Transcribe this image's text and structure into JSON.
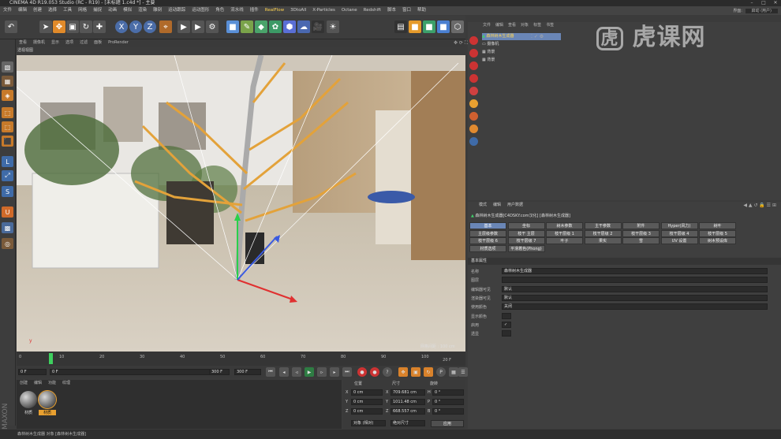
{
  "app": {
    "title": "CINEMA 4D R19.053 Studio (RC - R19) - [未标题 1.c4d *] - 主要"
  },
  "menu": [
    "文件",
    "编辑",
    "创建",
    "选择",
    "工具",
    "网格",
    "捕捉",
    "动画",
    "模拟",
    "渲染",
    "雕刻",
    "运动跟踪",
    "运动图形",
    "角色",
    "流水线",
    "插件",
    "RealFlow",
    "3DtoAll",
    "X-Particles",
    "Octane",
    "Redshift",
    "脚本",
    "窗口",
    "帮助"
  ],
  "menu_highlight": "RealFlow",
  "layout_label": "界面:",
  "layout_value": "启动 (用户)",
  "viewport": {
    "menu": [
      "查看",
      "摄像机",
      "显示",
      "选项",
      "过滤",
      "面板",
      "ProRender"
    ],
    "title": "透视视图",
    "grid": "网格间距 : 100 cm"
  },
  "timeline": {
    "ticks": [
      "0",
      "10",
      "20",
      "30",
      "40",
      "50",
      "60",
      "70",
      "80",
      "90",
      "100"
    ],
    "frame_end_right": "20 F",
    "current_frame": "0 F",
    "start": "0 F",
    "end": "300 F",
    "end2": "300 F"
  },
  "materials": {
    "menu": [
      "创建",
      "编辑",
      "功能",
      "纹理"
    ],
    "items": [
      {
        "label": "材质"
      },
      {
        "label": "材质"
      }
    ]
  },
  "coords": {
    "headers": [
      "位置",
      "尺寸",
      "旋转"
    ],
    "rows": [
      {
        "axis": "X",
        "pos": "0 cm",
        "size": "709.681 cm",
        "rot_axis": "H",
        "rot": "0 °"
      },
      {
        "axis": "Y",
        "pos": "0 cm",
        "size": "1011.48 cm",
        "rot_axis": "P",
        "rot": "0 °"
      },
      {
        "axis": "Z",
        "pos": "0 cm",
        "size": "668.557 cm",
        "rot_axis": "B",
        "rot": "0 °"
      }
    ],
    "mode1": "对象 (相对)",
    "mode2": "绝对尺寸",
    "apply": "应用"
  },
  "objects": {
    "menu": [
      "文件",
      "编辑",
      "查看",
      "对象",
      "标签",
      "书签"
    ],
    "items": [
      {
        "name": "森林树木生成器",
        "selected": true
      },
      {
        "name": "摄像机"
      },
      {
        "name": "背景"
      },
      {
        "name": "背景"
      }
    ]
  },
  "attributes": {
    "menu": [
      "模式",
      "编辑",
      "用户数据"
    ],
    "object_title": "森林树木生成器[C4DSKY.com汉化] [森林树木生成器]",
    "tabs": [
      [
        "基本",
        "坐标",
        "树木参数",
        "主干参数",
        "附件",
        "Hyper(风力)",
        "树叶"
      ],
      [
        "主层级参数",
        "枝干 主层",
        "枝干层级 1",
        "枝干层级 2",
        "枝干层级 3",
        "枝干层级 4",
        "枝干层级 5"
      ],
      [
        "枝干层级 6",
        "枝干层级 7",
        "叶子",
        "果实",
        "雪",
        "UV 设置",
        "树木预设库"
      ],
      [
        "材质选项",
        "平滑着色(Phong)"
      ]
    ],
    "section": "基本属性",
    "fields": [
      {
        "label": "名称",
        "value": "森林树木生成器"
      },
      {
        "label": "图层",
        "value": ""
      },
      {
        "label": "编辑器可见",
        "value": "默认"
      },
      {
        "label": "渲染器可见",
        "value": "默认"
      },
      {
        "label": "使用颜色",
        "value": "关闭"
      },
      {
        "label": "显示颜色",
        "value": ""
      },
      {
        "label": "启用",
        "value": "✓"
      },
      {
        "label": "透显",
        "value": ""
      }
    ]
  },
  "status": "森林树木生成器 对象 [森林树木生成器]",
  "watermark": "虎课网",
  "colors": {
    "accent_blue": "#6a86b6",
    "selection_orange": "#e8a030",
    "tree_outline": "#e3a23a"
  }
}
